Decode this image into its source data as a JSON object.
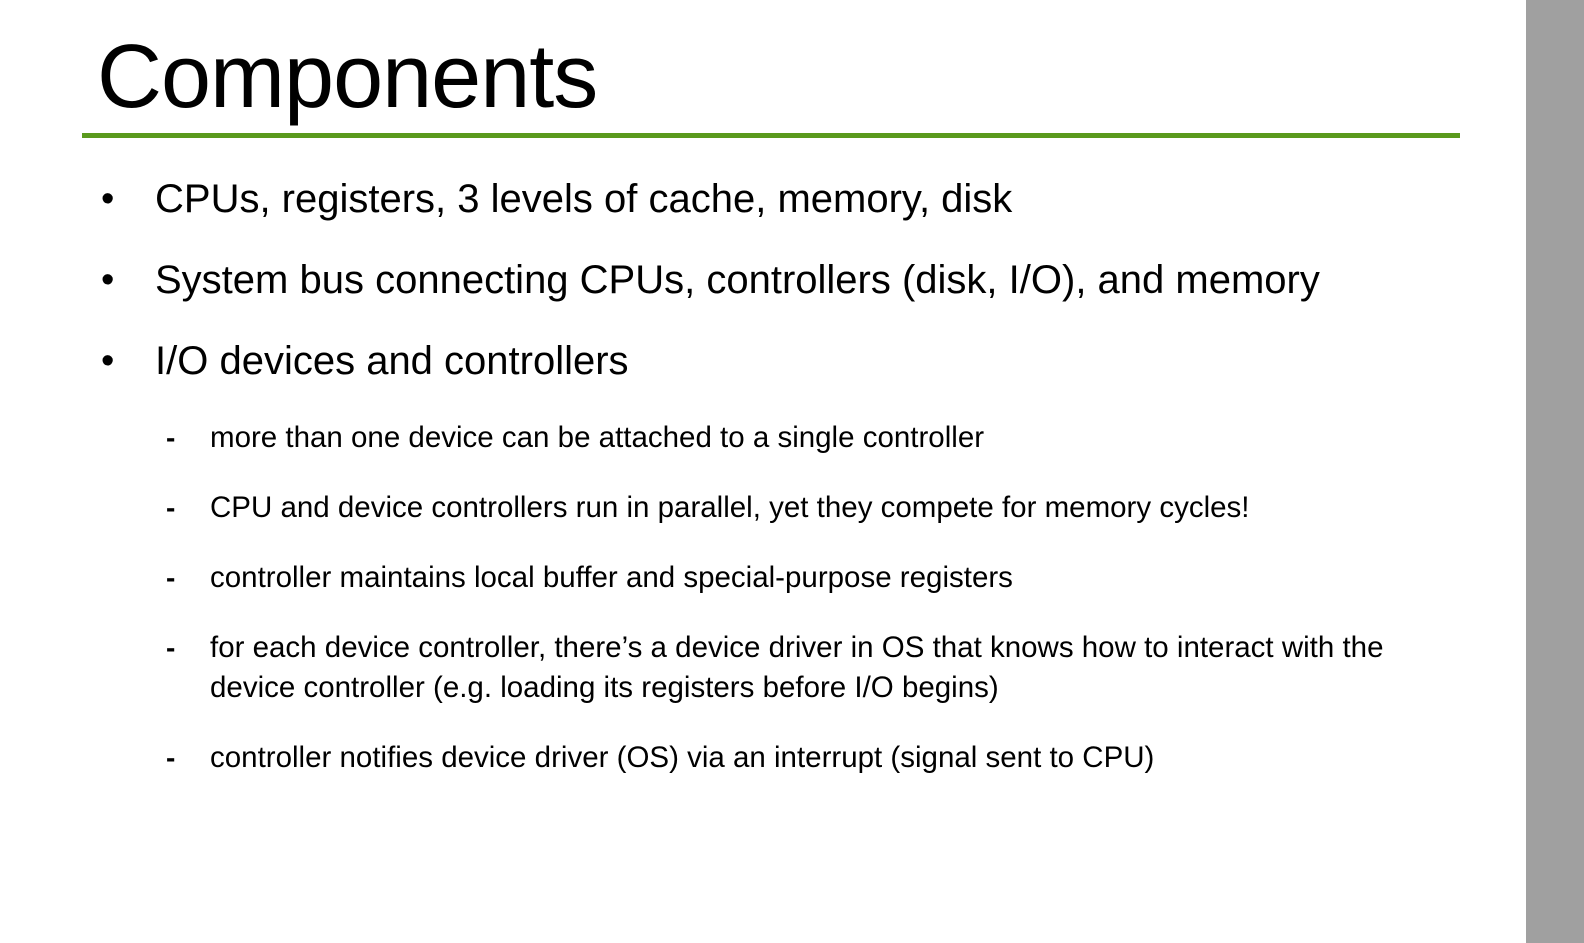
{
  "slide": {
    "title": "Components",
    "accent_color": "#5a9a1d",
    "bullets": [
      {
        "marker": "•",
        "text": "CPUs, registers, 3 levels of cache, memory, disk"
      },
      {
        "marker": "•",
        "text": "System bus connecting CPUs, controllers (disk, I/O), and memory"
      },
      {
        "marker": "•",
        "text": "I/O devices and controllers"
      }
    ],
    "sub_bullets": [
      {
        "marker": "-",
        "text": "more than one device can be attached to a single controller"
      },
      {
        "marker": "-",
        "text": "CPU and device controllers run in parallel, yet they compete for memory cycles!"
      },
      {
        "marker": "-",
        "text": "controller maintains local buffer and special-purpose registers"
      },
      {
        "marker": "-",
        "text": "for each device controller, there’s a device driver in OS that knows how to interact with the device controller (e.g. loading its registers before I/O begins)"
      },
      {
        "marker": "-",
        "text": "controller notifies device driver (OS) via an interrupt (signal sent to CPU)"
      }
    ]
  }
}
